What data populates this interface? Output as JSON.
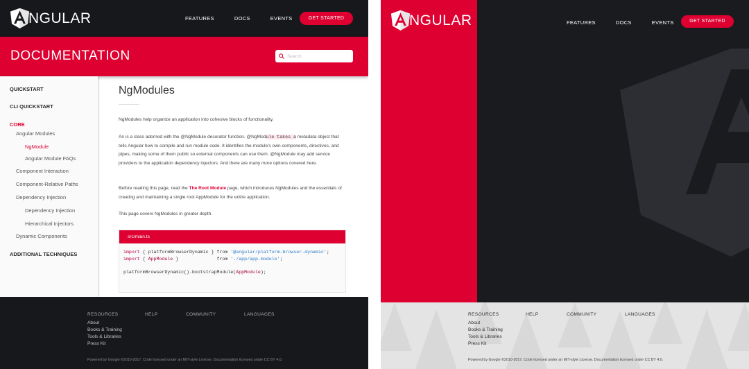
{
  "brand": {
    "name": "NGULAR",
    "logo_letter": "A"
  },
  "nav": {
    "features": "FEATURES",
    "docs": "DOCS",
    "events": "EVENTS",
    "get_started": "GET STARTED"
  },
  "doc_header": {
    "title": "DOCUMENTATION",
    "search_placeholder": "Search"
  },
  "sidenav": {
    "quickstart": "QUICKSTART",
    "cli_quickstart": "CLI QUICKSTART",
    "core": "CORE",
    "angular_modules": "Angular Modules",
    "ngmodule": "NgModule",
    "ngmodule_faqs": "Angular Module FAQs",
    "component_interaction": "Component Interaction",
    "component_relative_paths": "Component-Relative Paths",
    "dependency_injection": "Dependency Injection",
    "dependency_injection_sub": "Dependency Injection",
    "hierarchical_injectors": "Hierarchical Injectors",
    "dynamic_components": "Dynamic Components",
    "additional_techniques": "ADDITIONAL TECHNIQUES"
  },
  "content": {
    "title": "NgModules",
    "p1": "NgModules help organize an application into cohesive blocks of functionality.",
    "p2_a": "An    is a class adorned with the @NgModule decorator function.  @NgMod",
    "p2_hl": "ule takes a",
    "p2_b": " metadata object that tells Angular how to compile and run module code. It identifies the module's own components, directives, and pipes, making some of them public so external components can use them. @NgModule may add service providers to the application dependency injectors. And there are many more options covered here.",
    "p3_a": "Before reading this page, read the ",
    "p3_link": "The Root Module",
    "p3_b": " page, which introduces NgModules and the essentials of creating and maintaining a single root AppModule for the entire application.",
    "p4": "This page covers NgModules in greater depth."
  },
  "code": {
    "filename": "src/main.ts",
    "l1_kw": "import",
    "l1_a": " { platformBrowserDynamic } from ",
    "l1_str": "'@angular/platform-browser-dynamic'",
    "l1_end": ";",
    "l2_kw": "import",
    "l2_a": " { ",
    "l2_id": "AppModule",
    "l2_b": " }              from ",
    "l2_str": "'./app/app.module'",
    "l2_end": ";",
    "l4_a": "platformBrowserDynamic().bootstrapModule(",
    "l4_id": "AppModule",
    "l4_end": ");"
  },
  "footer": {
    "resources": "RESOURCES",
    "help": "HELP",
    "community": "COMMUNITY",
    "languages": "LANGUAGES",
    "about": "About",
    "books_training": "Books & Training",
    "tools_libraries": "Tools & Libraries",
    "press_kit": "Press Kit",
    "copyright": "Powered by Google ©2010-2017. Code licensed under an MIT-style License. Documentation licensed under CC BY 4.0."
  },
  "colors": {
    "accent": "#dd0031",
    "dark": "#17181c"
  }
}
